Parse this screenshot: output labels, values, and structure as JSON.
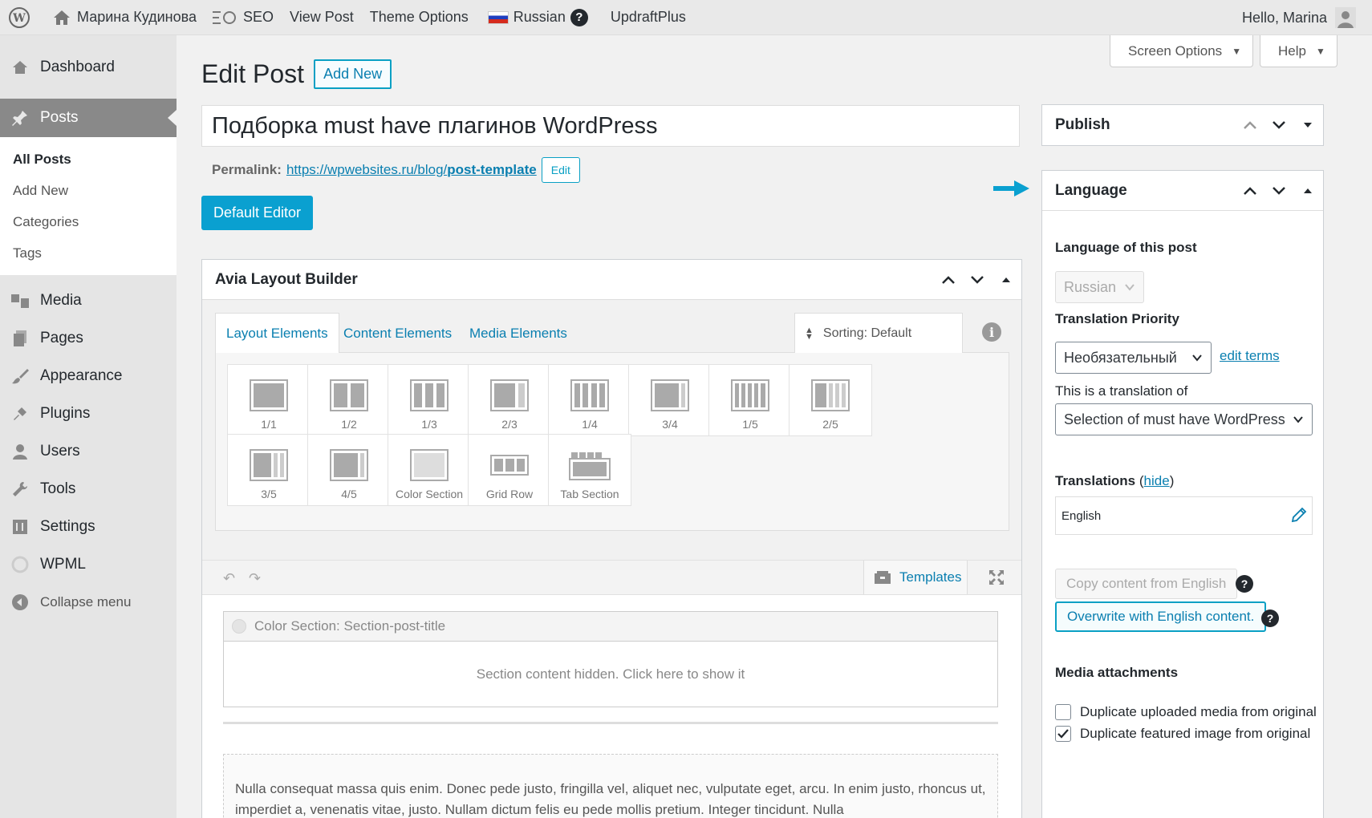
{
  "adminbar": {
    "site_name": "Марина Кудинова",
    "seo": "SEO",
    "view_post": "View Post",
    "theme_options": "Theme Options",
    "language": "Russian",
    "updraft": "UpdraftPlus",
    "greeting": "Hello, Marina"
  },
  "sidebar": {
    "dashboard": "Dashboard",
    "posts": "Posts",
    "sub": [
      "All Posts",
      "Add New",
      "Categories",
      "Tags"
    ],
    "media": "Media",
    "pages": "Pages",
    "appearance": "Appearance",
    "plugins": "Plugins",
    "users": "Users",
    "tools": "Tools",
    "settings": "Settings",
    "wpml": "WPML",
    "collapse": "Collapse menu"
  },
  "screen_options": "Screen Options",
  "help": "Help",
  "page": {
    "title": "Edit Post",
    "add_new": "Add New",
    "post_title": "Подборка must have плагинов WordPress",
    "permalink_label": "Permalink:",
    "permalink_base": "https://wpwebsites.ru/blog/",
    "permalink_slug": "post-template",
    "permalink_edit": "Edit",
    "default_editor": "Default Editor"
  },
  "avia": {
    "title": "Avia Layout Builder",
    "tabs": [
      "Layout Elements",
      "Content Elements",
      "Media Elements"
    ],
    "sorting": "Sorting: Default",
    "elements": [
      "1/1",
      "1/2",
      "1/3",
      "2/3",
      "1/4",
      "3/4",
      "1/5",
      "2/5",
      "3/5",
      "4/5",
      "Color Section",
      "Grid Row",
      "Tab Section"
    ],
    "templates": "Templates",
    "color_section_title": "Color Section: Section-post-title",
    "section_hidden": "Section content hidden. Click here to show it",
    "body_text": "Nulla consequat massa quis enim. Donec pede justo, fringilla vel, aliquet nec, vulputate eget, arcu. In enim justo, rhoncus ut, imperdiet a, venenatis vitae, justo. Nullam dictum felis eu pede mollis pretium. Integer tincidunt. Nulla"
  },
  "publish": {
    "title": "Publish"
  },
  "language_box": {
    "title": "Language",
    "language_of_post": "Language of this post",
    "language_value": "Russian",
    "translation_priority": "Translation Priority",
    "priority_value": "Необязательный",
    "edit_terms": "edit terms",
    "translation_of": "This is a translation of",
    "translation_of_value": "Selection of must have WordPress p",
    "translations_label": "Translations",
    "hide": "hide",
    "translation_lang": "English",
    "copy_content": "Copy content from English",
    "overwrite": "Overwrite with English content.",
    "media_attachments": "Media attachments",
    "dup_media": "Duplicate uploaded media from original",
    "dup_featured": "Duplicate featured image from original",
    "dup_media_checked": false,
    "dup_featured_checked": true
  }
}
